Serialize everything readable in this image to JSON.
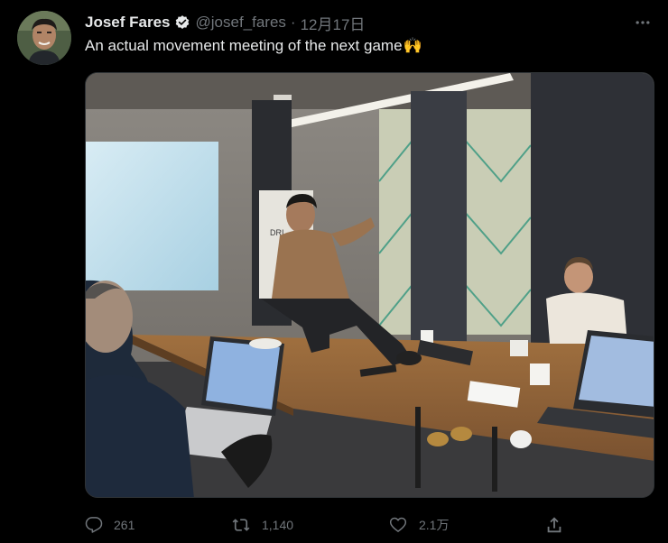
{
  "tweet": {
    "author_name": "Josef Fares",
    "handle": "@josef_fares",
    "separator": "·",
    "date": "12月17日",
    "text": "An actual movement meeting of the next game",
    "emoji": "🙌"
  },
  "icons": {
    "avatar": "avatar",
    "verified": "verified-badge-icon",
    "more": "more-icon",
    "reply": "reply-icon",
    "retweet": "retweet-icon",
    "like": "heart-icon",
    "share": "share-icon"
  },
  "stats": {
    "replies": "261",
    "retweets": "1,140",
    "likes": "2.1万"
  },
  "media": {
    "sign_text": "DRI"
  },
  "colors": {
    "background": "#000000",
    "text": "#e7e9ea",
    "muted": "#71767b"
  }
}
